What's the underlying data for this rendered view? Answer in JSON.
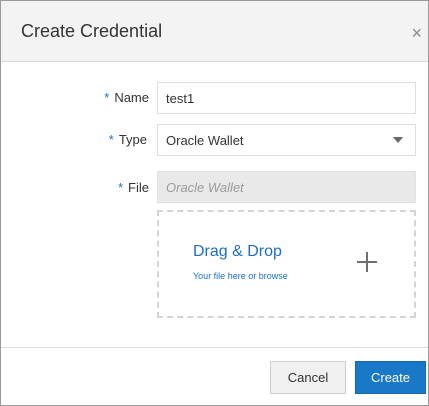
{
  "dialog": {
    "title": "Create Credential",
    "close_glyph": "×"
  },
  "form": {
    "required_marker": "*",
    "name": {
      "label": "Name",
      "value": "test1"
    },
    "type": {
      "label": "Type",
      "selected": "Oracle Wallet"
    },
    "file": {
      "label": "File",
      "placeholder": "Oracle Wallet"
    }
  },
  "dropzone": {
    "title": "Drag & Drop",
    "subtitle": "Your file here or browse",
    "icon": "plus-icon"
  },
  "footer": {
    "cancel_label": "Cancel",
    "create_label": "Create"
  },
  "colors": {
    "accent": "#1a78c8",
    "link": "#1a6fc2",
    "header_bg": "#f3f3f3"
  }
}
